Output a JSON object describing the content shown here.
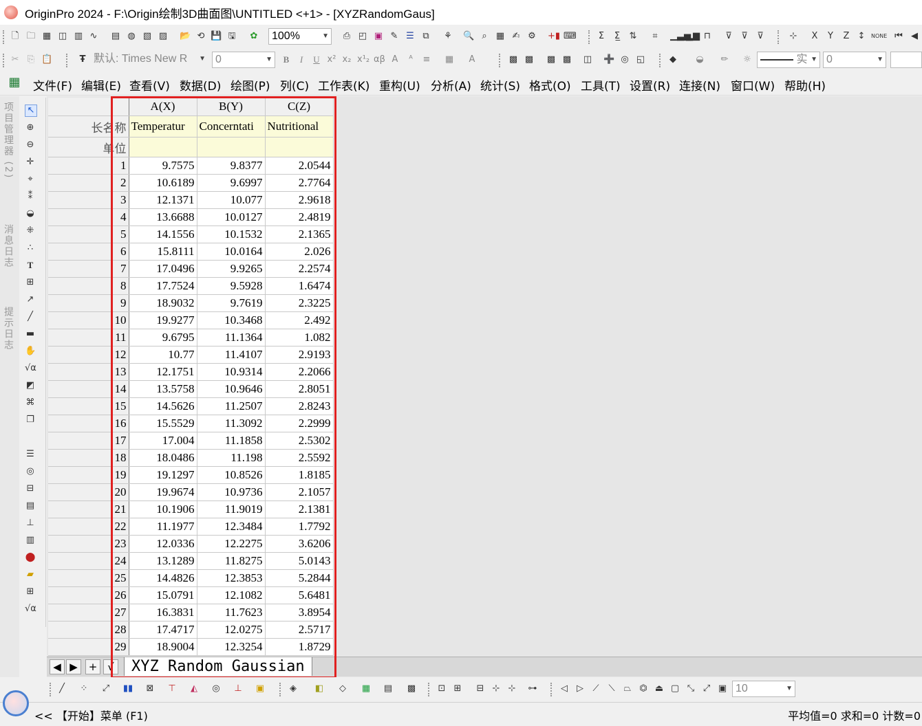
{
  "window": {
    "title": "OriginPro 2024 - F:\\Origin绘制3D曲面图\\UNTITLED <+1> - [XYZRandomGaus]"
  },
  "toolbar": {
    "zoom": "100%",
    "font_name": "默认: Times New R",
    "font_size": "0",
    "line_style": "实",
    "line_width": "0",
    "bottom_size": "10"
  },
  "menu": [
    {
      "label": "文件(F)"
    },
    {
      "label": "编辑(E)"
    },
    {
      "label": "查看(V)"
    },
    {
      "label": "数据(D)"
    },
    {
      "label": "绘图(P)"
    },
    {
      "label": "列(C)"
    },
    {
      "label": "工作表(K)"
    },
    {
      "label": "重构(U)"
    },
    {
      "label": "分析(A)"
    },
    {
      "label": "统计(S)"
    },
    {
      "label": "格式(O)"
    },
    {
      "label": "工具(T)"
    },
    {
      "label": "设置(R)"
    },
    {
      "label": "连接(N)"
    },
    {
      "label": "窗口(W)"
    },
    {
      "label": "帮助(H)"
    }
  ],
  "side_tabs": [
    "项目管理器 (2)",
    "消息日志",
    "提示日志"
  ],
  "sheet": {
    "columns": [
      {
        "header": "A(X)",
        "long_name": "Temperatur"
      },
      {
        "header": "B(Y)",
        "long_name": "Concerntati"
      },
      {
        "header": "C(Z)",
        "long_name": "Nutritional"
      }
    ],
    "row_labels": {
      "long_name": "长名称",
      "units": "单位"
    },
    "rows": [
      [
        "1",
        "9.7575",
        "9.8377",
        "2.0544"
      ],
      [
        "2",
        "10.6189",
        "9.6997",
        "2.7764"
      ],
      [
        "3",
        "12.1371",
        "10.077",
        "2.9618"
      ],
      [
        "4",
        "13.6688",
        "10.0127",
        "2.4819"
      ],
      [
        "5",
        "14.1556",
        "10.1532",
        "2.1365"
      ],
      [
        "6",
        "15.8111",
        "10.0164",
        "2.026"
      ],
      [
        "7",
        "17.0496",
        "9.9265",
        "2.2574"
      ],
      [
        "8",
        "17.7524",
        "9.5928",
        "1.6474"
      ],
      [
        "9",
        "18.9032",
        "9.7619",
        "2.3225"
      ],
      [
        "10",
        "19.9277",
        "10.3468",
        "2.492"
      ],
      [
        "11",
        "9.6795",
        "11.1364",
        "1.082"
      ],
      [
        "12",
        "10.77",
        "11.4107",
        "2.9193"
      ],
      [
        "13",
        "12.1751",
        "10.9314",
        "2.2066"
      ],
      [
        "14",
        "13.5758",
        "10.9646",
        "2.8051"
      ],
      [
        "15",
        "14.5626",
        "11.2507",
        "2.8243"
      ],
      [
        "16",
        "15.5529",
        "11.3092",
        "2.2999"
      ],
      [
        "17",
        "17.004",
        "11.1858",
        "2.5302"
      ],
      [
        "18",
        "18.0486",
        "11.198",
        "2.5592"
      ],
      [
        "19",
        "19.1297",
        "10.8526",
        "1.8185"
      ],
      [
        "20",
        "19.9674",
        "10.9736",
        "2.1057"
      ],
      [
        "21",
        "10.1906",
        "11.9019",
        "2.1381"
      ],
      [
        "22",
        "11.1977",
        "12.3484",
        "1.7792"
      ],
      [
        "23",
        "12.0336",
        "12.2275",
        "3.6206"
      ],
      [
        "24",
        "13.1289",
        "11.8275",
        "5.0143"
      ],
      [
        "25",
        "14.4826",
        "12.3853",
        "5.2844"
      ],
      [
        "26",
        "15.0791",
        "12.1082",
        "5.6481"
      ],
      [
        "27",
        "16.3831",
        "11.7623",
        "3.8954"
      ],
      [
        "28",
        "17.4717",
        "12.0275",
        "2.5717"
      ],
      [
        "29",
        "18.9004",
        "12.3254",
        "1.8729"
      ]
    ],
    "tab_name": "XYZ Random Gaussian"
  },
  "sheet_nav": {
    "prev": "◀",
    "next": "▶",
    "add": "+",
    "check": "√"
  },
  "status": {
    "start_menu": "<< 【开始】菜单 (F1)",
    "stats": "平均值=0 求和=0 计数=0"
  },
  "colors": {
    "highlight": "#e02020",
    "meta_row": "#fbfbd9"
  }
}
